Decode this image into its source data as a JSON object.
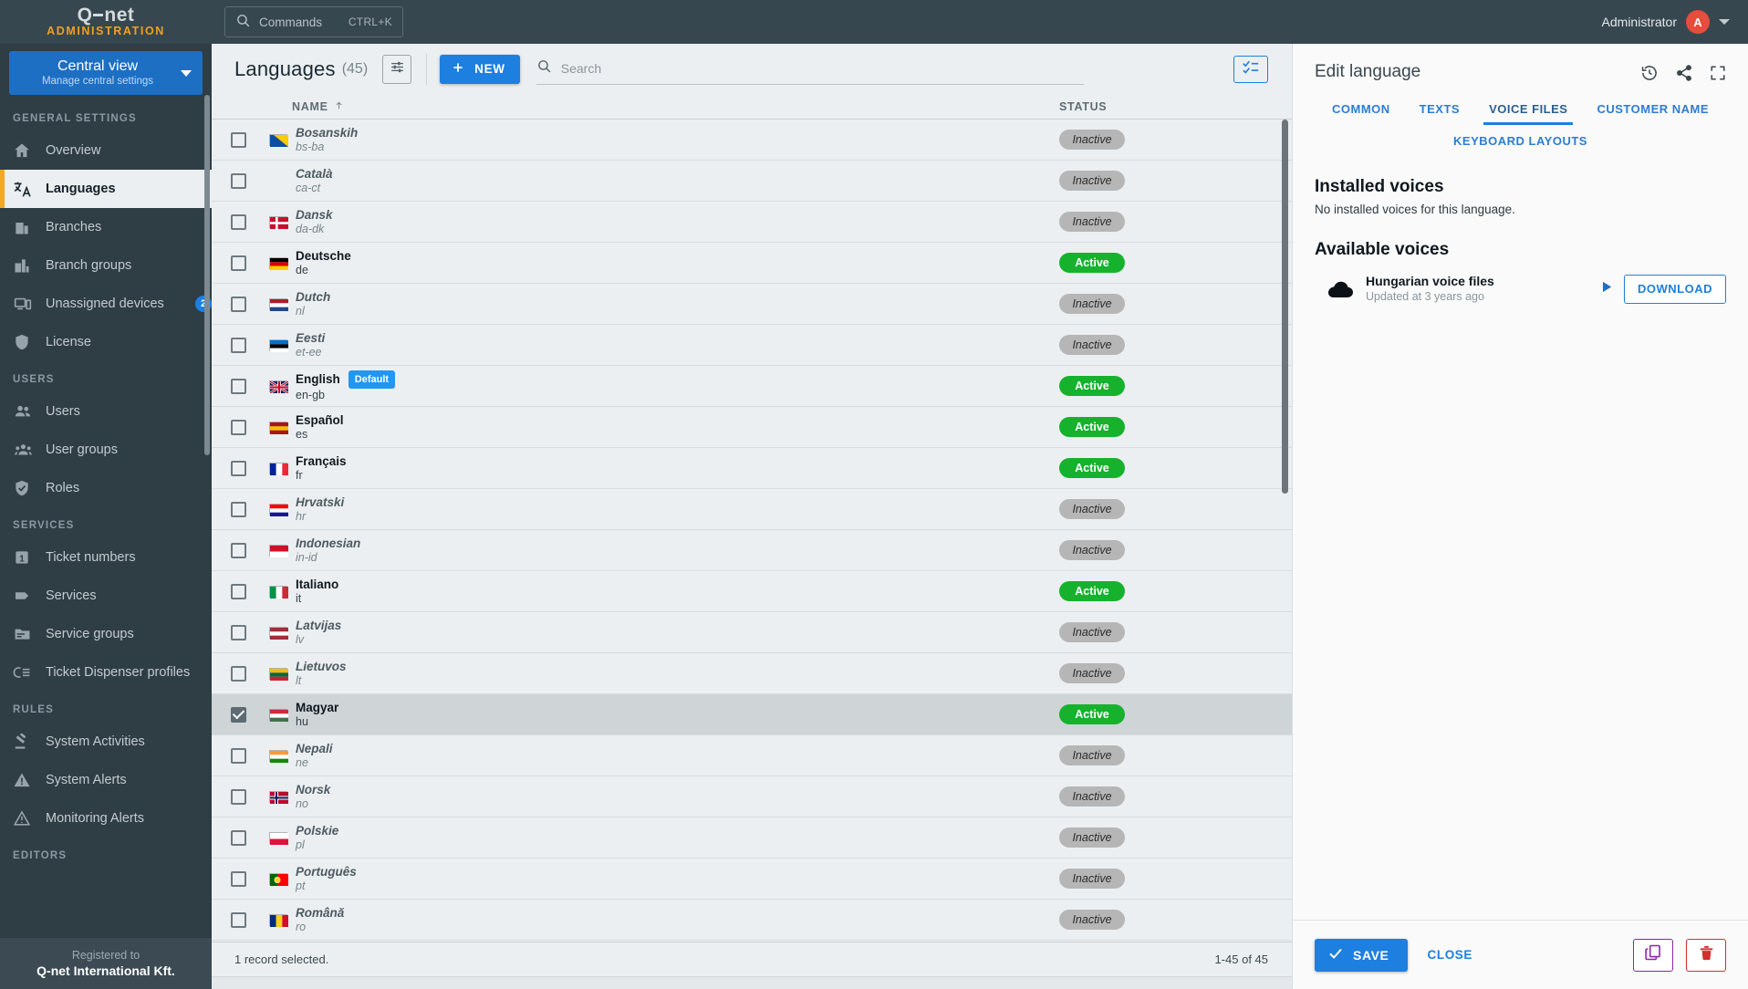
{
  "app": {
    "brand_name": "Q net",
    "brand_name_part1": "Q",
    "brand_name_part2": "net",
    "brand_subtitle": "ADMINISTRATION"
  },
  "topbar": {
    "commands_label": "Commands",
    "commands_shortcut": "CTRL+K",
    "search_icon": "search-icon",
    "user_name": "Administrator",
    "avatar_initial": "A",
    "caret_icon": "chevron-down-icon"
  },
  "sidebar": {
    "view_switch": {
      "title": "Central view",
      "subtitle": "Manage central settings",
      "caret_icon": "chevron-down-icon"
    },
    "groups": [
      {
        "title": "GENERAL SETTINGS",
        "items": [
          {
            "label": "Overview",
            "icon": "home-icon",
            "active": false
          },
          {
            "label": "Languages",
            "icon": "translate-icon",
            "active": true
          },
          {
            "label": "Branches",
            "icon": "building-icon",
            "active": false
          },
          {
            "label": "Branch groups",
            "icon": "buildings-icon",
            "active": false
          },
          {
            "label": "Unassigned devices",
            "icon": "devices-icon",
            "active": false,
            "badge": "2"
          },
          {
            "label": "License",
            "icon": "shield-icon",
            "active": false
          }
        ]
      },
      {
        "title": "USERS",
        "items": [
          {
            "label": "Users",
            "icon": "users-icon",
            "active": false
          },
          {
            "label": "User groups",
            "icon": "user-group-icon",
            "active": false
          },
          {
            "label": "Roles",
            "icon": "shield-check-icon",
            "active": false
          }
        ]
      },
      {
        "title": "SERVICES",
        "items": [
          {
            "label": "Ticket numbers",
            "icon": "number-one-icon",
            "active": false
          },
          {
            "label": "Services",
            "icon": "tag-icon",
            "active": false
          },
          {
            "label": "Service groups",
            "icon": "folder-icon",
            "active": false
          },
          {
            "label": "Ticket Dispenser profiles",
            "icon": "dispenser-icon",
            "active": false
          }
        ]
      },
      {
        "title": "RULES",
        "items": [
          {
            "label": "System Activities",
            "icon": "gavel-icon",
            "active": false
          },
          {
            "label": "System Alerts",
            "icon": "alert-filled-icon",
            "active": false
          },
          {
            "label": "Monitoring Alerts",
            "icon": "alert-outline-icon",
            "active": false
          }
        ]
      },
      {
        "title": "EDITORS",
        "items": []
      }
    ],
    "registered": {
      "caption": "Registered to",
      "company": "Q-net International Kft."
    }
  },
  "main": {
    "page_title": "Languages",
    "page_count": "(45)",
    "filter_icon": "filter-settings-icon",
    "new_button": "NEW",
    "new_icon": "plus-icon",
    "search_placeholder": "Search",
    "search_value": "",
    "search_icon": "search-icon",
    "select_list_icon": "checklist-icon",
    "columns": {
      "name": "NAME",
      "status": "STATUS",
      "sort_icon": "arrow-up-icon"
    },
    "rows": [
      {
        "name": "Bosanskih",
        "code": "bs-ba",
        "status": "Inactive",
        "active": false,
        "selected": false,
        "flag": [
          "#0b4ea2",
          "#fecb00"
        ],
        "flag_type": "diag"
      },
      {
        "name": "Català",
        "code": "ca-ct",
        "status": "Inactive",
        "active": false,
        "selected": false,
        "flag": [],
        "flag_type": "none"
      },
      {
        "name": "Dansk",
        "code": "da-dk",
        "status": "Inactive",
        "active": false,
        "selected": false,
        "flag": [
          "#c8102e",
          "#ffffff"
        ],
        "flag_type": "nordic"
      },
      {
        "name": "Deutsche",
        "code": "de",
        "status": "Active",
        "active": true,
        "selected": false,
        "flag": [
          "#000000",
          "#dd0000",
          "#ffce00"
        ],
        "flag_type": "hbands"
      },
      {
        "name": "Dutch",
        "code": "nl",
        "status": "Inactive",
        "active": false,
        "selected": false,
        "flag": [
          "#ae1c28",
          "#ffffff",
          "#21468b"
        ],
        "flag_type": "hbands"
      },
      {
        "name": "Eesti",
        "code": "et-ee",
        "status": "Inactive",
        "active": false,
        "selected": false,
        "flag": [
          "#0072ce",
          "#000000",
          "#ffffff"
        ],
        "flag_type": "hbands"
      },
      {
        "name": "English",
        "code": "en-gb",
        "status": "Active",
        "active": true,
        "selected": false,
        "badge": "Default",
        "flag": [
          "#012169",
          "#ffffff",
          "#c8102e"
        ],
        "flag_type": "uk"
      },
      {
        "name": "Español",
        "code": "es",
        "status": "Active",
        "active": true,
        "selected": false,
        "flag": [
          "#aa151b",
          "#f1bf00",
          "#aa151b"
        ],
        "flag_type": "hbands"
      },
      {
        "name": "Français",
        "code": "fr",
        "status": "Active",
        "active": true,
        "selected": false,
        "flag": [
          "#002395",
          "#ffffff",
          "#ed2939"
        ],
        "flag_type": "vbands"
      },
      {
        "name": "Hrvatski",
        "code": "hr",
        "status": "Inactive",
        "active": false,
        "selected": false,
        "flag": [
          "#ff0000",
          "#ffffff",
          "#171796"
        ],
        "flag_type": "hbands"
      },
      {
        "name": "Indonesian",
        "code": "in-id",
        "status": "Inactive",
        "active": false,
        "selected": false,
        "flag": [
          "#ce1126",
          "#ffffff"
        ],
        "flag_type": "hbands2"
      },
      {
        "name": "Italiano",
        "code": "it",
        "status": "Active",
        "active": true,
        "selected": false,
        "flag": [
          "#009246",
          "#ffffff",
          "#ce2b37"
        ],
        "flag_type": "vbands"
      },
      {
        "name": "Latvijas",
        "code": "lv",
        "status": "Inactive",
        "active": false,
        "selected": false,
        "flag": [
          "#9e3039",
          "#ffffff",
          "#9e3039"
        ],
        "flag_type": "hbands"
      },
      {
        "name": "Lietuvos",
        "code": "lt",
        "status": "Inactive",
        "active": false,
        "selected": false,
        "flag": [
          "#fdb913",
          "#006a44",
          "#c1272d"
        ],
        "flag_type": "hbands"
      },
      {
        "name": "Magyar",
        "code": "hu",
        "status": "Active",
        "active": true,
        "selected": true,
        "flag": [
          "#cd2a3e",
          "#ffffff",
          "#436f4d"
        ],
        "flag_type": "hbands"
      },
      {
        "name": "Nepali",
        "code": "ne",
        "status": "Inactive",
        "active": false,
        "selected": false,
        "flag": [
          "#ff9933",
          "#ffffff",
          "#138808"
        ],
        "flag_type": "hbands"
      },
      {
        "name": "Norsk",
        "code": "no",
        "status": "Inactive",
        "active": false,
        "selected": false,
        "flag": [
          "#ba0c2f",
          "#ffffff",
          "#00205b"
        ],
        "flag_type": "nordic2"
      },
      {
        "name": "Polskie",
        "code": "pl",
        "status": "Inactive",
        "active": false,
        "selected": false,
        "flag": [
          "#ffffff",
          "#dc143c"
        ],
        "flag_type": "hbands2"
      },
      {
        "name": "Português",
        "code": "pt",
        "status": "Inactive",
        "active": false,
        "selected": false,
        "flag": [
          "#006600",
          "#ff0000"
        ],
        "flag_type": "vbands2"
      },
      {
        "name": "Română",
        "code": "ro",
        "status": "Inactive",
        "active": false,
        "selected": false,
        "flag": [
          "#002b7f",
          "#fcd116",
          "#ce1126"
        ],
        "flag_type": "vbands"
      }
    ],
    "footer": {
      "selection_text": "1 record selected.",
      "pagination": "1-45 of 45"
    }
  },
  "panel": {
    "title": "Edit language",
    "head_icons": [
      {
        "name": "history-icon"
      },
      {
        "name": "share-icon"
      },
      {
        "name": "fullscreen-icon"
      }
    ],
    "tabs_row1": [
      {
        "label": "COMMON",
        "active": false
      },
      {
        "label": "TEXTS",
        "active": false
      },
      {
        "label": "VOICE FILES",
        "active": true
      },
      {
        "label": "CUSTOMER NAME",
        "active": false
      }
    ],
    "tabs_row2": [
      {
        "label": "KEYBOARD LAYOUTS",
        "active": false
      }
    ],
    "installed_title": "Installed voices",
    "installed_note": "No installed voices for this language.",
    "available_title": "Available voices",
    "available_voices": [
      {
        "name": "Hungarian voice files",
        "updated": "Updated at 3 years ago",
        "icon": "cloud-icon",
        "play_icon": "play-icon",
        "download_label": "DOWNLOAD"
      }
    ],
    "footer": {
      "save_label": "SAVE",
      "save_icon": "check-icon",
      "close_label": "CLOSE",
      "copy_icon": "copy-icon",
      "delete_icon": "trash-icon"
    }
  },
  "colors": {
    "accent_blue": "#1d7fe0",
    "active_green": "#16b22e",
    "sidebar_bg": "#2f3d45",
    "topbar_bg": "#37474f",
    "sidebar_active_bar": "#f5a623",
    "avatar_red": "#e74c3c",
    "brand_orange": "#f0a020",
    "delete_red": "#d32f2f",
    "copy_purple": "#8e24aa"
  }
}
